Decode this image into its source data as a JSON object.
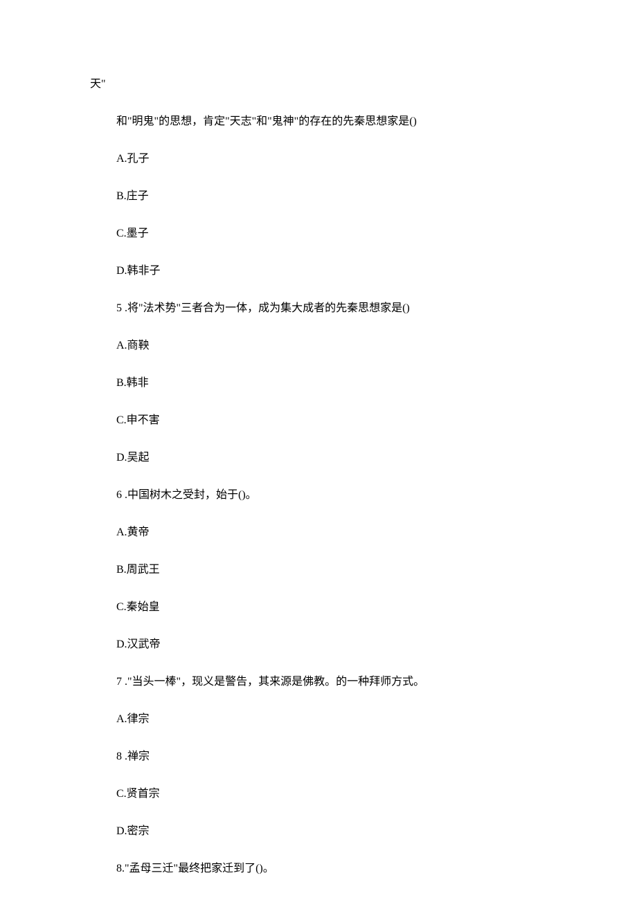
{
  "hanging": "天\"",
  "continuation": " 和\"明鬼\"的思想，肯定\"天志\"和\"鬼神\"的存在的先秦思想家是()",
  "q4": {
    "A": "A.孔子",
    "B": "B.庄子",
    "C": "C.墨子",
    "D": "D.韩非子"
  },
  "q5": {
    "stem": "5  .将\"法术势\"三者合为一体，成为集大成者的先秦思想家是()",
    "A": "A.商鞅",
    "B": "B.韩非",
    "C": "C.申不害",
    "D": "D.吴起"
  },
  "q6": {
    "stem": "6  .中国树木之受封，始于()。",
    "A": "A.黄帝",
    "B": "B.周武王",
    "C": "C.秦始皇",
    "D": "D.汉武帝"
  },
  "q7": {
    "stem": "7  .\"当头一棒\"，现义是警告，其来源是佛教。的一种拜师方式。",
    "A": "A.律宗",
    "B8": "8  .禅宗",
    "C": "C.贤首宗",
    "D": "D.密宗"
  },
  "q8": {
    "stem": "8.\"孟母三迁\"最终把家迁到了()。"
  }
}
